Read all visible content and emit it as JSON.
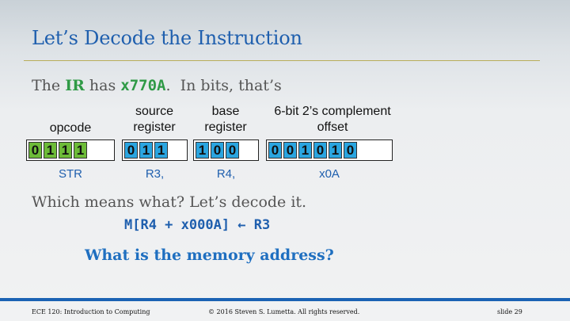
{
  "title": "Let’s Decode the Instruction",
  "intro": {
    "prefix": "The ",
    "ir": "IR",
    "has": " has ",
    "hex": "x770A",
    "suffix": ".  In bits, that’s"
  },
  "fields": [
    {
      "label_line1": "",
      "label_line2": "opcode",
      "bits": [
        "0",
        "1",
        "1",
        "1"
      ],
      "meaning": "STR"
    },
    {
      "label_line1": "source",
      "label_line2": "register",
      "bits": [
        "0",
        "1",
        "1"
      ],
      "meaning": "R3,"
    },
    {
      "label_line1": "base",
      "label_line2": "register",
      "bits": [
        "1",
        "0",
        "0"
      ],
      "meaning": "R4,"
    },
    {
      "label_line1": "6-bit 2’s complement",
      "label_line2": "offset",
      "bits": [
        "0",
        "0",
        "1",
        "0",
        "1",
        "0"
      ],
      "meaning": "x0A"
    }
  ],
  "question": "Which means what?  Let’s decode it.",
  "rtl": "M[R4 + x000A] ← R3",
  "ask": "What is the memory address?",
  "footer": {
    "left": "ECE 120: Introduction to Computing",
    "center": "© 2016 Steven S. Lumetta.  All rights reserved.",
    "right": "slide 29"
  },
  "colors": {
    "title": "#1f5fae",
    "opcode_bits": "#6dbb38",
    "other_bits": "#2aa5e0",
    "footer_bar": "#1b63b4"
  }
}
